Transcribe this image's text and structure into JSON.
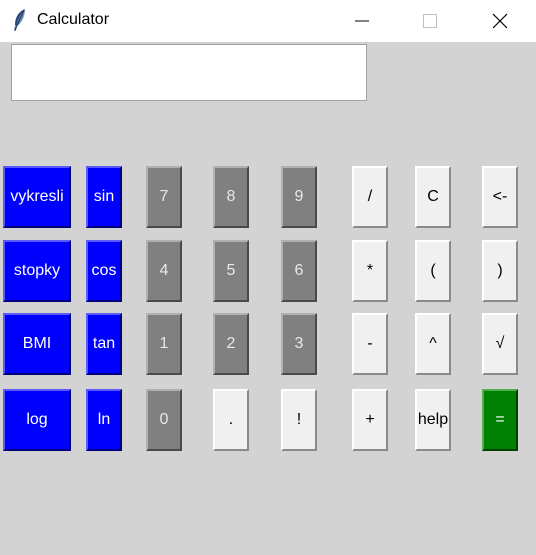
{
  "window": {
    "title": "Calculator",
    "icon": "feather-icon",
    "controls": [
      "minimize-icon",
      "maximize-icon",
      "close-icon"
    ]
  },
  "display": {
    "value": ""
  },
  "buttons": {
    "vykresli": "vykresli",
    "sin": "sin",
    "b7": "7",
    "b8": "8",
    "b9": "9",
    "div": "/",
    "clear": "C",
    "back": "<-",
    "stopky": "stopky",
    "cos": "cos",
    "b4": "4",
    "b5": "5",
    "b6": "6",
    "mul": "*",
    "lparen": "(",
    "rparen": ")",
    "bmi": "BMI",
    "tan": "tan",
    "b1": "1",
    "b2": "2",
    "b3": "3",
    "sub": "-",
    "pow": "^",
    "sqrt": "√",
    "log": "log",
    "ln": "ln",
    "b0": "0",
    "dot": ".",
    "fact": "!",
    "add": "+",
    "help": "help",
    "eq": "="
  },
  "colors": {
    "blue": "#0000ff",
    "gray": "#808080",
    "light": "#f0f0f0",
    "green": "#008000",
    "background": "#d3d3d3"
  }
}
